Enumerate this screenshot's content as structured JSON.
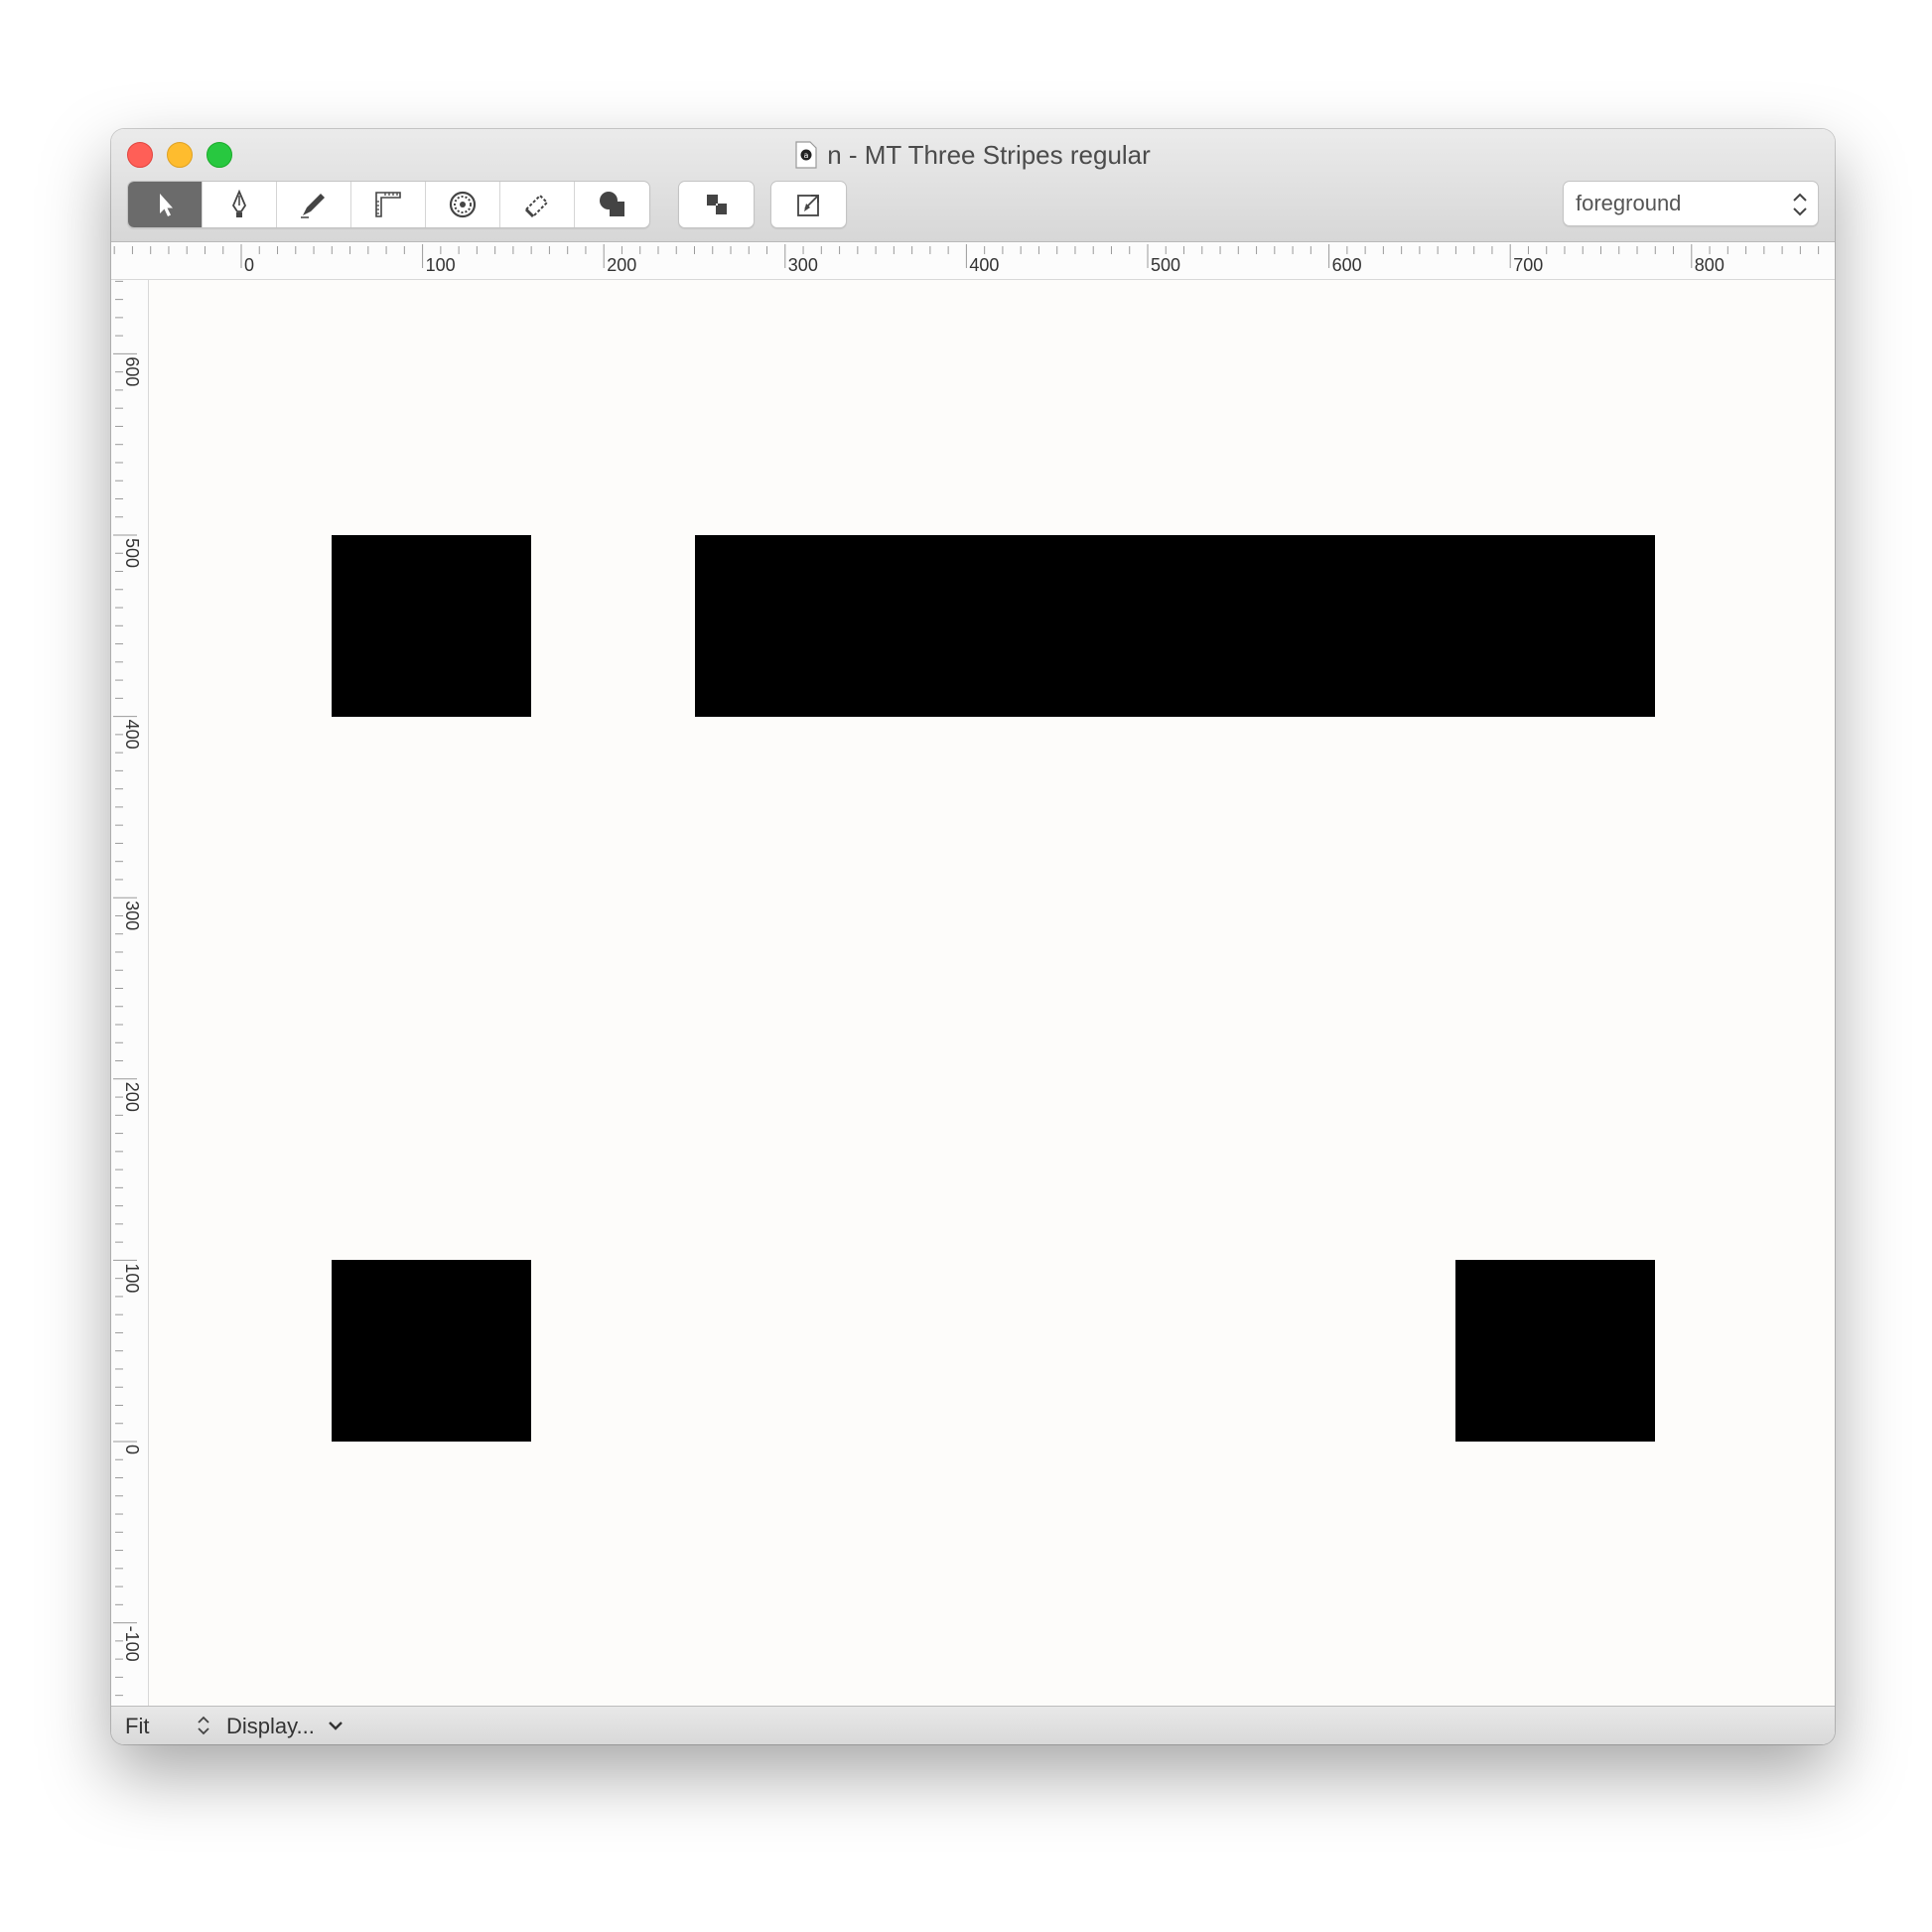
{
  "window": {
    "title": "n - MT Three Stripes regular",
    "document_icon": "font-document-icon"
  },
  "toolbar": {
    "tools": [
      {
        "name": "select-tool",
        "icon": "arrow-pointer-icon",
        "active": true
      },
      {
        "name": "pen-tool",
        "icon": "pen-nib-icon",
        "active": false
      },
      {
        "name": "pencil-tool",
        "icon": "pencil-knife-icon",
        "active": false
      },
      {
        "name": "measure-tool",
        "icon": "ruler-corner-icon",
        "active": false
      },
      {
        "name": "rotate-tool",
        "icon": "dotted-circle-icon",
        "active": false
      },
      {
        "name": "eraser-tool",
        "icon": "dashed-eraser-icon",
        "active": false
      },
      {
        "name": "shapes-tool",
        "icon": "shapes-icon",
        "active": false
      }
    ],
    "layer_select": {
      "value": "foreground"
    }
  },
  "rulers": {
    "horizontal_labels": [
      "0",
      "100",
      "200",
      "300",
      "400",
      "500",
      "600",
      "700",
      "800"
    ],
    "vertical_labels": [
      "600",
      "500",
      "400",
      "300",
      "200",
      "100",
      "0",
      "-100"
    ]
  },
  "glyph": {
    "units": "font units",
    "rectangles": [
      {
        "x_min": 50,
        "x_max": 160,
        "y_min": 400,
        "y_max": 500
      },
      {
        "x_min": 250,
        "x_max": 780,
        "y_min": 400,
        "y_max": 500
      },
      {
        "x_min": 50,
        "x_max": 160,
        "y_min": 0,
        "y_max": 100
      },
      {
        "x_min": 670,
        "x_max": 780,
        "y_min": 0,
        "y_max": 100
      }
    ],
    "fill_color": "#000000"
  },
  "statusbar": {
    "zoom": "Fit",
    "display_menu": "Display..."
  }
}
